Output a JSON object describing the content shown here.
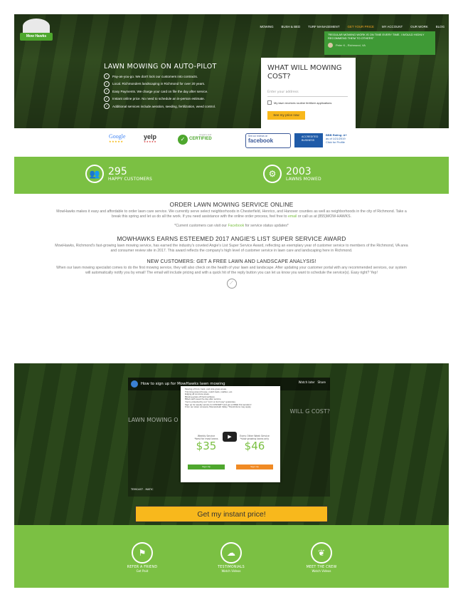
{
  "header": {
    "logo_text": "Mow Hawks",
    "nav": [
      "MOWING",
      "BUSH & BED",
      "TURF MANAGEMENT",
      "GET YOUR PRICE",
      "MY ACCOUNT",
      "OUR WORK",
      "BLOG"
    ],
    "active_nav": "GET YOUR PRICE",
    "testimonial": {
      "quote": "\"REGULAR MOWING WORK IS ON TIME EVERY TIME. I WOULD HIGHLY RECOMMEND THEM TO OTHERS\"",
      "author": "Peter K., Richmond, VA"
    }
  },
  "hero": {
    "title": "LAWN MOWING ON AUTO-PILOT",
    "bullets": [
      "Pay-as-you-go. We don't lock our customers into contracts.",
      "Local. Richmonders landscaping in Richmond for over 20 years.",
      "Easy Payments. We charge your card on file the day after service.",
      "Instant online price. No need to schedule an in-person estimate.",
      "Additional services include aeration, seeding, fertilization, weed control."
    ],
    "cost_box": {
      "title": "WHAT WILL MOWING COST?",
      "address_placeholder": "Enter your address",
      "fertilizer_label": "My lawn receives routine fertilizer applications",
      "button": "See my price now"
    }
  },
  "badges": {
    "google": "Google",
    "yelp": "yelp",
    "angies": "CERTIFIED",
    "angies_top": "Angie's List",
    "facebook_top": "See our reviews on",
    "facebook": "facebook",
    "bbb": "ACCREDITED BUSINESS",
    "bbb_rating": "BBB Rating: A+",
    "bbb_date": "as of 1/21/2019",
    "bbb_profile": "Click for Profile"
  },
  "stats": [
    {
      "number": "295",
      "label": "HAPPY CUSTOMERS"
    },
    {
      "number": "2003",
      "label": "LAWNS MOWED"
    }
  ],
  "content": {
    "h1": "ORDER LAWN MOWING SERVICE ONLINE",
    "p1": "MowHawks makes it easy and affordable to order lawn care service. We currently serve select neighborhoods in Chesterfield, Henrico, and Hanover counties as well as neighborhoods in the city of Richmond. Take a break this spring and let us do all the work. If you need assistance with the online order process, feel free to",
    "p1_link": "email",
    "p1_end": "or call us at (855)MOW-HAWKS.",
    "p2_start": "*Current customers can visit our",
    "p2_link": "Facebook",
    "p2_end": "for service status updates*",
    "h2": "MOWHAWKS EARNS ESTEEMED 2017 ANGIE'S LIST SUPER SERVICE AWARD",
    "p3": "MowHawks, Richmond's fast-growing lawn mowing service, has earned the industry's coveted Angie's List Super Service Award, reflecting an exemplary year of customer service to members of the Richmond, VA area and consumer review site in 2017. This award reflects the company's high level of customer service in lawn care and landscaping here in Richmond.",
    "h3": "NEW CUSTOMERS: GET A FREE LAWN AND LANDSCAPE ANALYSIS!",
    "p4": "When our lawn mowing specialist comes to do the first mowing service, they will also check on the health of your lawn and landscape. After updating your customer portal with any recommended services, our system will automatically notify you by email! The email will include pricing and with a quick hit of the reply button you can let us know you want to schedule the service(s). Easy right? Yep!"
  },
  "video": {
    "title": "How to sign up for MowHawks lawn mowing",
    "watch_later": "Watch later",
    "share": "Share",
    "bg_title": "LAWN MOWING O",
    "bg_cost": "WILL G COST?",
    "card_lines": [
      "Mowing of front, back, and side grass areas.",
      "Trimming around house, mulch beds, mailbox, etc.",
      "Edging all concrete areas.",
      "Blowing grass off hard surfaces.",
      "Billed each week the day after service.",
      "You're protected by our \"cut it or don't pay\" guarantee.",
      "Sign up for weekly service & CONVERT and get a FREE first aeration!",
      "From our sister company Shenandoah Valley. *Restrictions may apply."
    ],
    "plans": [
      {
        "name": "Weekly Service",
        "sub": "*best for most lawns",
        "price": "$35",
        "button": "Sign Up"
      },
      {
        "name": "Every Other Week Service",
        "sub": "*slow growing lawns only",
        "price": "$46",
        "button": "Sign Up"
      }
    ],
    "footer_text": "TEMCAST . MATIC",
    "cta": "Get my instant price!"
  },
  "footer": [
    {
      "title": "REFER A FRIEND",
      "sub": "Get Paid"
    },
    {
      "title": "TESTIMONIALS",
      "sub": "Watch Videos"
    },
    {
      "title": "MEET THE CREW",
      "sub": "Watch Videos"
    }
  ]
}
